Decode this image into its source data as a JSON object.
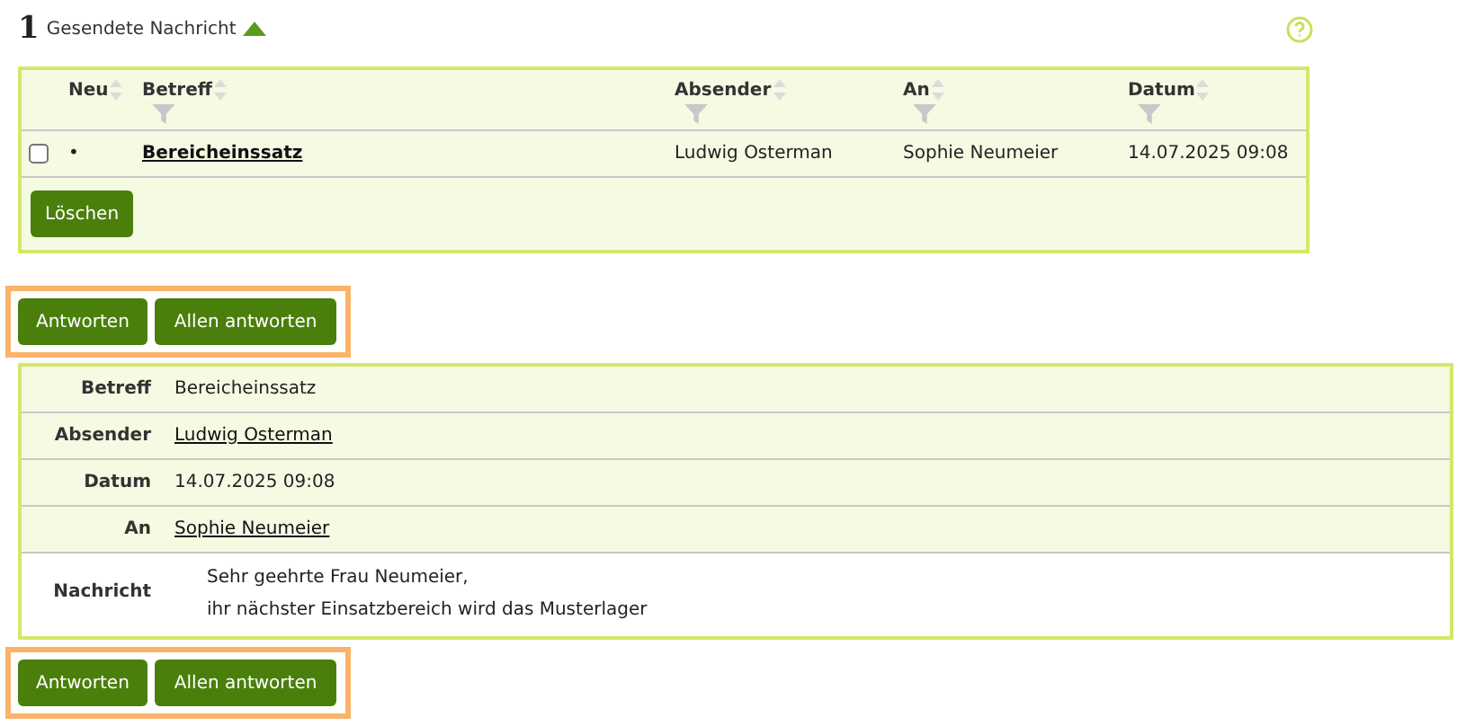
{
  "header": {
    "count": "1",
    "title": "Gesendete Nachricht",
    "expanded": true
  },
  "table": {
    "columns": [
      {
        "label": "Neu",
        "filter": false
      },
      {
        "label": "Betreff",
        "filter": true
      },
      {
        "label": "Absender",
        "filter": true
      },
      {
        "label": "An",
        "filter": true
      },
      {
        "label": "Datum",
        "filter": true
      }
    ],
    "rows": [
      {
        "checked": false,
        "new_marker": "•",
        "subject": "Bereicheinssatz",
        "sender": "Ludwig Osterman",
        "recipient": "Sophie Neumeier",
        "date": "14.07.2025 09:08"
      }
    ],
    "delete_button": "Löschen"
  },
  "reply_bars": [
    {
      "buttons": [
        "Antworten",
        "Allen antworten"
      ]
    },
    {
      "buttons": [
        "Antworten",
        "Allen antworten"
      ]
    }
  ],
  "details": [
    {
      "kind": "text",
      "label": "Betreff",
      "value": "Bereicheinssatz"
    },
    {
      "kind": "link",
      "label": "Absender",
      "value": "Ludwig Osterman"
    },
    {
      "kind": "text",
      "label": "Datum",
      "value": "14.07.2025 09:08"
    },
    {
      "kind": "link",
      "label": "An",
      "value": "Sophie Neumeier"
    }
  ],
  "message": {
    "label": "Nachricht",
    "lines": [
      "Sehr geehrte Frau Neumeier,",
      "ihr nächster Einsatzbereich wird das Musterlager"
    ]
  }
}
